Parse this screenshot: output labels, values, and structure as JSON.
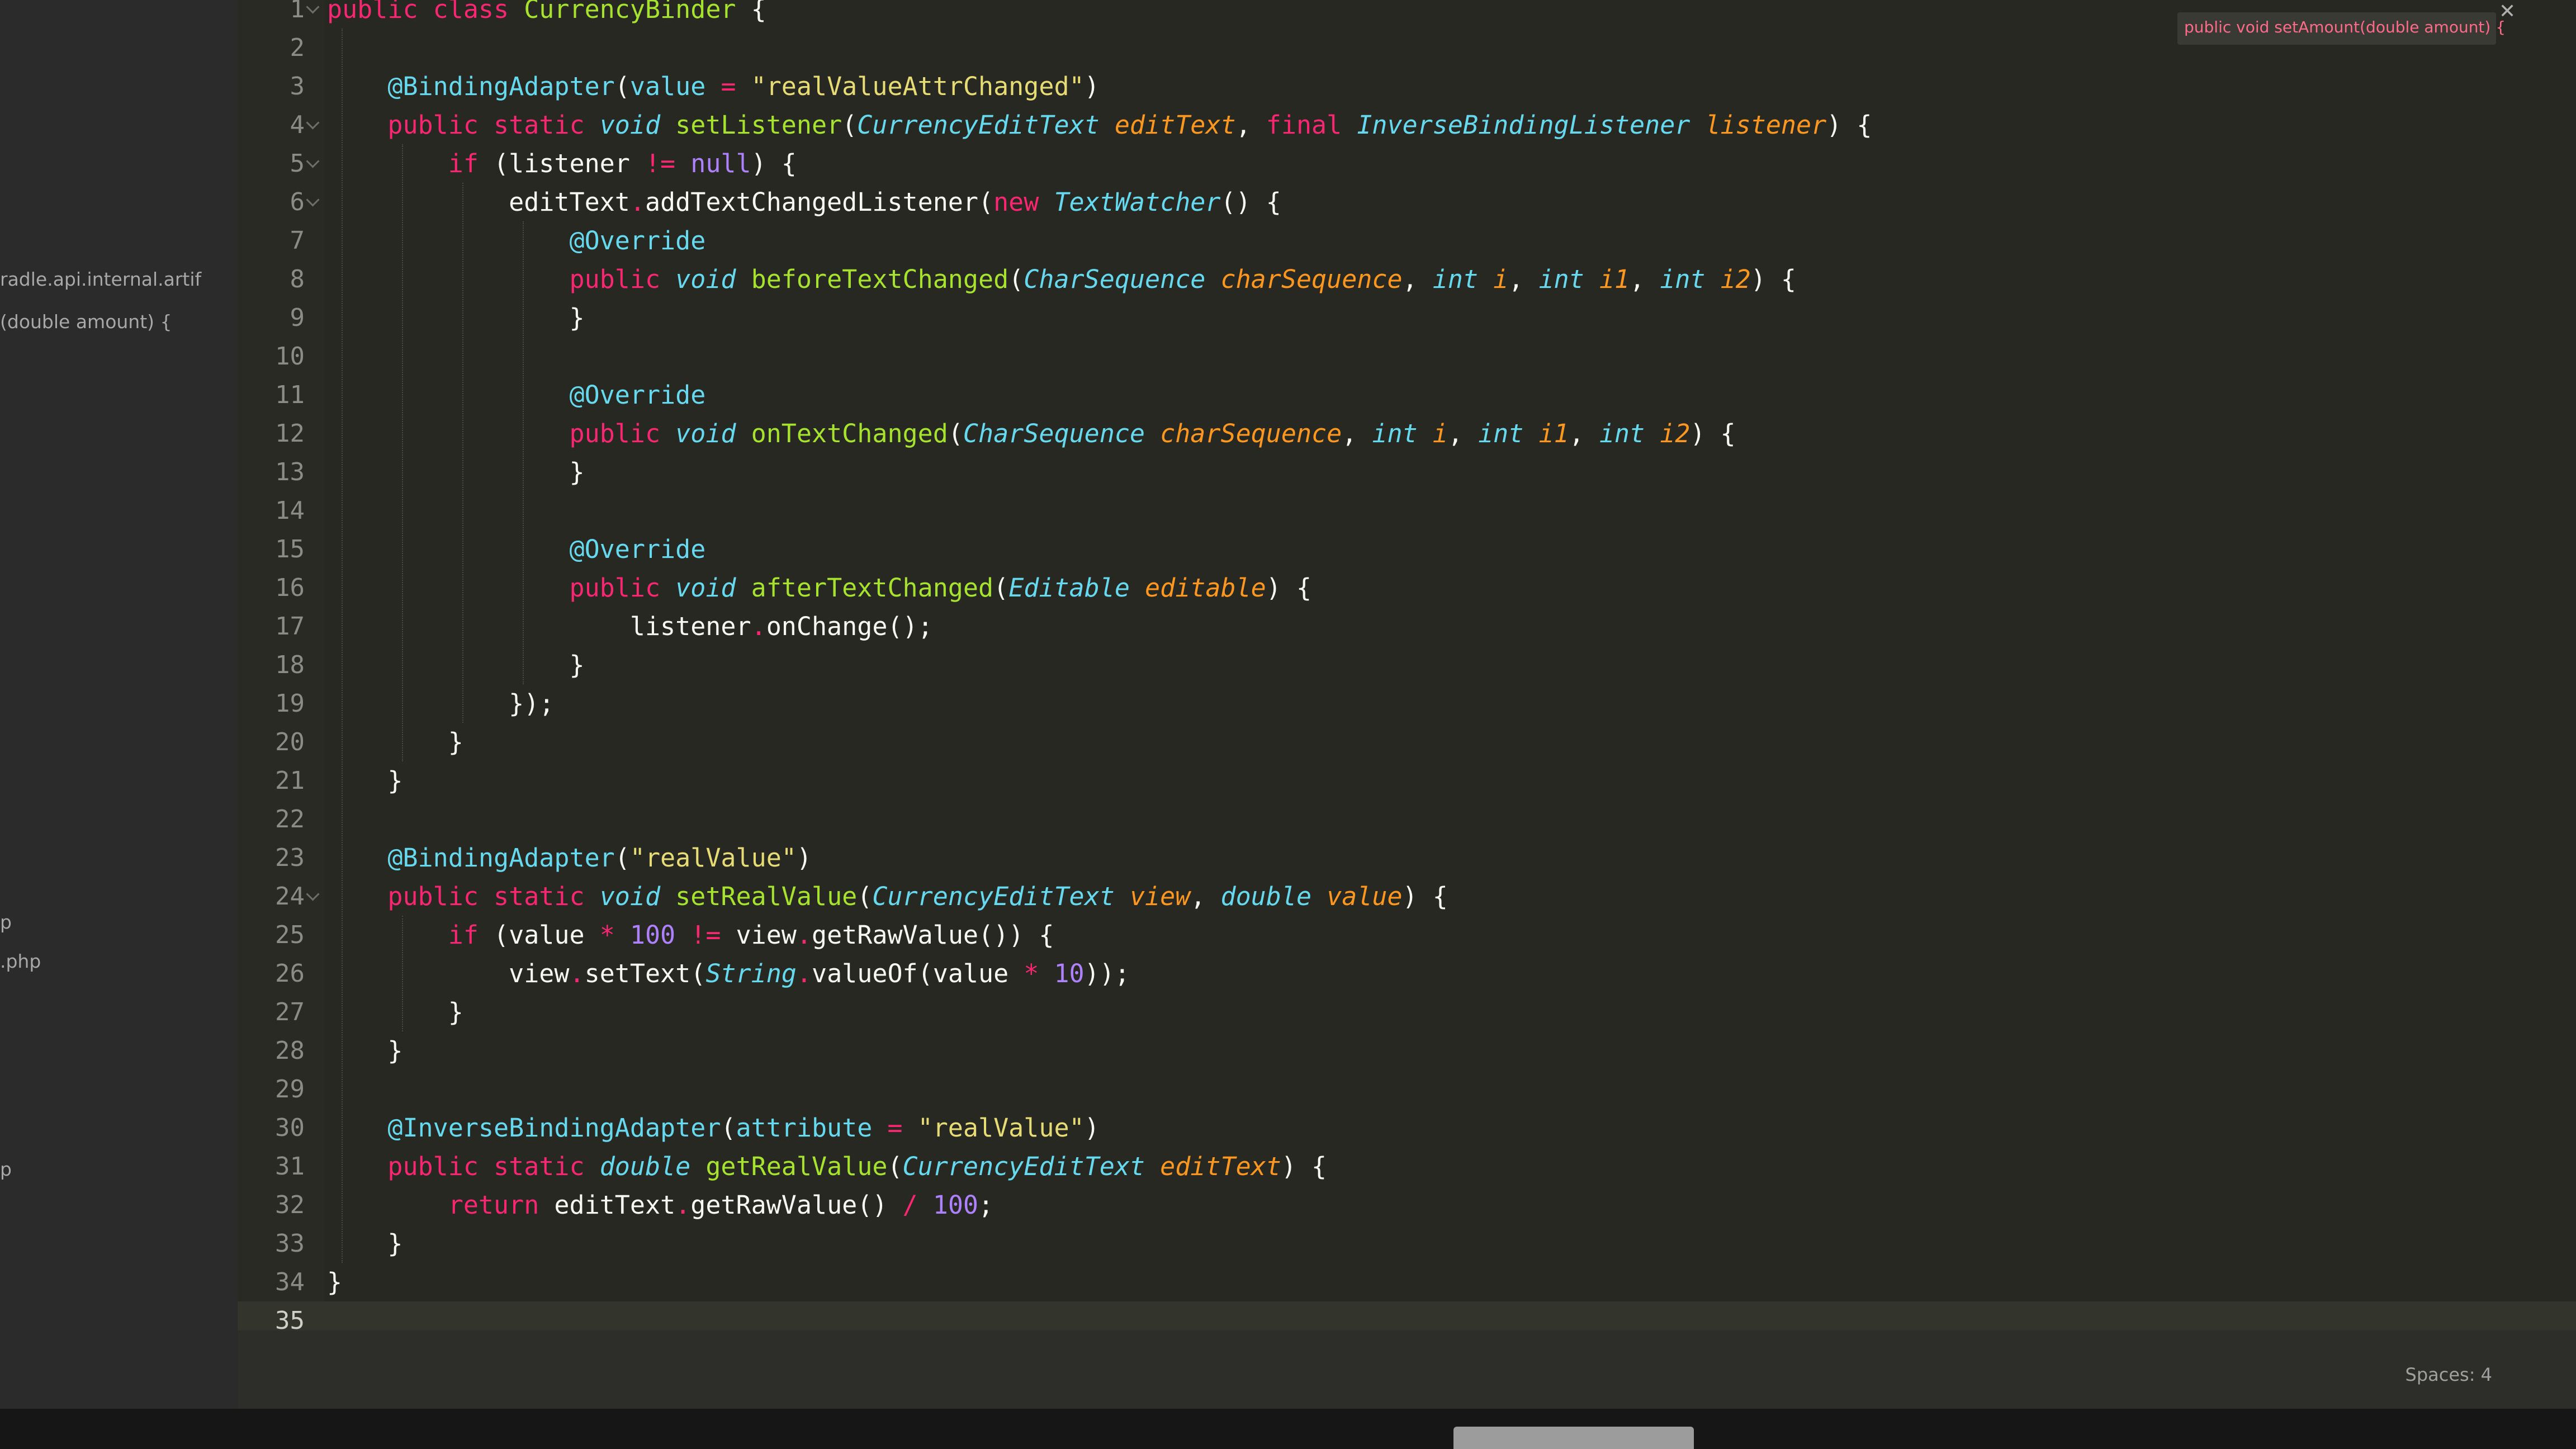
{
  "sidebar": {
    "items": [
      {
        "label": "radle.api.internal.artif"
      },
      {
        "label": "(double amount) {"
      },
      {
        "label": "p"
      },
      {
        "label": ".php"
      },
      {
        "label": "p"
      }
    ]
  },
  "hint": {
    "text": "public void setAmount(double amount) {",
    "close": "✕"
  },
  "status": {
    "spaces": "Spaces: 4"
  },
  "code": {
    "lines": [
      [
        [
          "kw",
          "public "
        ],
        [
          "kw",
          "class "
        ],
        [
          "fn",
          "CurrencyBinder"
        ],
        [
          "plain",
          " {"
        ]
      ],
      [],
      [
        [
          "plain",
          "    "
        ],
        [
          "ann",
          "@BindingAdapter"
        ],
        [
          "plain",
          "("
        ],
        [
          "ann",
          "value"
        ],
        [
          "op",
          " = "
        ],
        [
          "str",
          "\"realValueAttrChanged\""
        ],
        [
          "plain",
          ")"
        ]
      ],
      [
        [
          "plain",
          "    "
        ],
        [
          "kw",
          "public "
        ],
        [
          "kw",
          "static "
        ],
        [
          "type",
          "void "
        ],
        [
          "fn",
          "setListener"
        ],
        [
          "plain",
          "("
        ],
        [
          "type",
          "CurrencyEditText "
        ],
        [
          "param",
          "editText"
        ],
        [
          "plain",
          ", "
        ],
        [
          "kw",
          "final "
        ],
        [
          "type",
          "InverseBindingListener "
        ],
        [
          "param",
          "listener"
        ],
        [
          "plain",
          ") {"
        ]
      ],
      [
        [
          "plain",
          "        "
        ],
        [
          "kw",
          "if "
        ],
        [
          "plain",
          "(listener "
        ],
        [
          "op",
          "!= "
        ],
        [
          "num",
          "null"
        ],
        [
          "plain",
          ") {"
        ]
      ],
      [
        [
          "plain",
          "            editText"
        ],
        [
          "op",
          "."
        ],
        [
          "plain",
          "addTextChangedListener("
        ],
        [
          "kw",
          "new "
        ],
        [
          "type",
          "TextWatcher"
        ],
        [
          "plain",
          "() {"
        ]
      ],
      [
        [
          "plain",
          "                "
        ],
        [
          "ann",
          "@Override"
        ]
      ],
      [
        [
          "plain",
          "                "
        ],
        [
          "kw",
          "public "
        ],
        [
          "type",
          "void "
        ],
        [
          "fn",
          "beforeTextChanged"
        ],
        [
          "plain",
          "("
        ],
        [
          "type",
          "CharSequence "
        ],
        [
          "param",
          "charSequence"
        ],
        [
          "plain",
          ", "
        ],
        [
          "type",
          "int "
        ],
        [
          "param",
          "i"
        ],
        [
          "plain",
          ", "
        ],
        [
          "type",
          "int "
        ],
        [
          "param",
          "i1"
        ],
        [
          "plain",
          ", "
        ],
        [
          "type",
          "int "
        ],
        [
          "param",
          "i2"
        ],
        [
          "plain",
          ") {"
        ]
      ],
      [
        [
          "plain",
          "                }"
        ]
      ],
      [],
      [
        [
          "plain",
          "                "
        ],
        [
          "ann",
          "@Override"
        ]
      ],
      [
        [
          "plain",
          "                "
        ],
        [
          "kw",
          "public "
        ],
        [
          "type",
          "void "
        ],
        [
          "fn",
          "onTextChanged"
        ],
        [
          "plain",
          "("
        ],
        [
          "type",
          "CharSequence "
        ],
        [
          "param",
          "charSequence"
        ],
        [
          "plain",
          ", "
        ],
        [
          "type",
          "int "
        ],
        [
          "param",
          "i"
        ],
        [
          "plain",
          ", "
        ],
        [
          "type",
          "int "
        ],
        [
          "param",
          "i1"
        ],
        [
          "plain",
          ", "
        ],
        [
          "type",
          "int "
        ],
        [
          "param",
          "i2"
        ],
        [
          "plain",
          ") {"
        ]
      ],
      [
        [
          "plain",
          "                }"
        ]
      ],
      [],
      [
        [
          "plain",
          "                "
        ],
        [
          "ann",
          "@Override"
        ]
      ],
      [
        [
          "plain",
          "                "
        ],
        [
          "kw",
          "public "
        ],
        [
          "type",
          "void "
        ],
        [
          "fn",
          "afterTextChanged"
        ],
        [
          "plain",
          "("
        ],
        [
          "type",
          "Editable "
        ],
        [
          "param",
          "editable"
        ],
        [
          "plain",
          ") {"
        ]
      ],
      [
        [
          "plain",
          "                    listener"
        ],
        [
          "op",
          "."
        ],
        [
          "plain",
          "onChange();"
        ]
      ],
      [
        [
          "plain",
          "                }"
        ]
      ],
      [
        [
          "plain",
          "            });"
        ]
      ],
      [
        [
          "plain",
          "        }"
        ]
      ],
      [
        [
          "plain",
          "    }"
        ]
      ],
      [],
      [
        [
          "plain",
          "    "
        ],
        [
          "ann",
          "@BindingAdapter"
        ],
        [
          "plain",
          "("
        ],
        [
          "str",
          "\"realValue\""
        ],
        [
          "plain",
          ")"
        ]
      ],
      [
        [
          "plain",
          "    "
        ],
        [
          "kw",
          "public "
        ],
        [
          "kw",
          "static "
        ],
        [
          "type",
          "void "
        ],
        [
          "fn",
          "setRealValue"
        ],
        [
          "plain",
          "("
        ],
        [
          "type",
          "CurrencyEditText "
        ],
        [
          "param",
          "view"
        ],
        [
          "plain",
          ", "
        ],
        [
          "type",
          "double "
        ],
        [
          "param",
          "value"
        ],
        [
          "plain",
          ") {"
        ]
      ],
      [
        [
          "plain",
          "        "
        ],
        [
          "kw",
          "if "
        ],
        [
          "plain",
          "(value "
        ],
        [
          "op",
          "* "
        ],
        [
          "num",
          "100 "
        ],
        [
          "op",
          "!= "
        ],
        [
          "plain",
          "view"
        ],
        [
          "op",
          "."
        ],
        [
          "plain",
          "getRawValue()) {"
        ]
      ],
      [
        [
          "plain",
          "            view"
        ],
        [
          "op",
          "."
        ],
        [
          "plain",
          "setText("
        ],
        [
          "type",
          "String"
        ],
        [
          "op",
          "."
        ],
        [
          "plain",
          "valueOf(value "
        ],
        [
          "op",
          "* "
        ],
        [
          "num",
          "10"
        ],
        [
          "plain",
          "));"
        ]
      ],
      [
        [
          "plain",
          "        }"
        ]
      ],
      [
        [
          "plain",
          "    }"
        ]
      ],
      [],
      [
        [
          "plain",
          "    "
        ],
        [
          "ann",
          "@InverseBindingAdapter"
        ],
        [
          "plain",
          "("
        ],
        [
          "ann",
          "attribute"
        ],
        [
          "op",
          " = "
        ],
        [
          "str",
          "\"realValue\""
        ],
        [
          "plain",
          ")"
        ]
      ],
      [
        [
          "plain",
          "    "
        ],
        [
          "kw",
          "public "
        ],
        [
          "kw",
          "static "
        ],
        [
          "type",
          "double "
        ],
        [
          "fn",
          "getRealValue"
        ],
        [
          "plain",
          "("
        ],
        [
          "type",
          "CurrencyEditText "
        ],
        [
          "param",
          "editText"
        ],
        [
          "plain",
          ") {"
        ]
      ],
      [
        [
          "plain",
          "        "
        ],
        [
          "kw",
          "return "
        ],
        [
          "plain",
          "editText"
        ],
        [
          "op",
          "."
        ],
        [
          "plain",
          "getRawValue() "
        ],
        [
          "op",
          "/ "
        ],
        [
          "num",
          "100"
        ],
        [
          "plain",
          ";"
        ]
      ],
      [
        [
          "plain",
          "    }"
        ]
      ],
      [
        [
          "plain",
          "}"
        ]
      ],
      []
    ],
    "current_line": 35,
    "folded_lines": [
      1,
      4,
      5,
      6,
      24
    ]
  }
}
